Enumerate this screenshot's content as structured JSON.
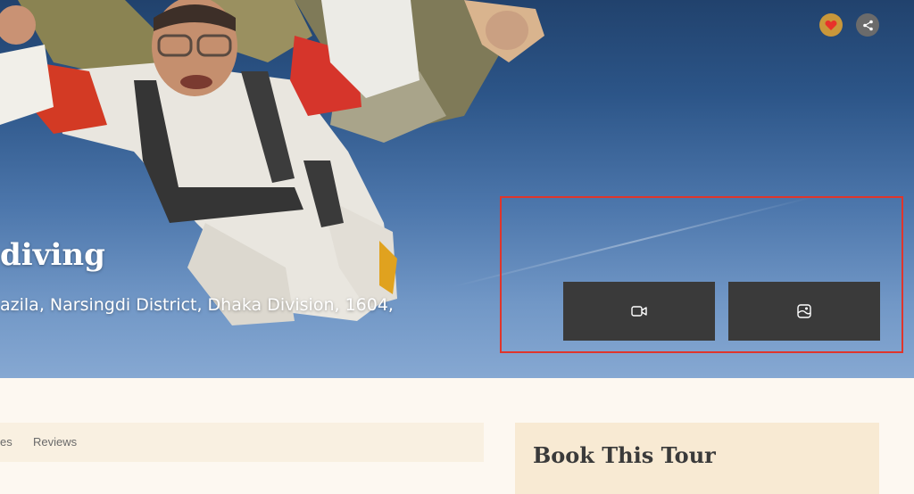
{
  "hero": {
    "title": "diving",
    "address": "azila, Narsingdi District, Dhaka Division, 1604,"
  },
  "actions": {
    "favorite_icon": "heart-icon",
    "share_icon": "share-icon",
    "favorite_color": "#c9973a",
    "heart_color": "#e8322a"
  },
  "media_buttons": {
    "video_icon": "video-camera-icon",
    "gallery_icon": "gallery-icon",
    "background": "#3a3a3a"
  },
  "highlight": {
    "border_color": "#e0352b"
  },
  "tabs": [
    {
      "label": "es"
    },
    {
      "label": "Reviews"
    }
  ],
  "booking": {
    "title": "Book This Tour"
  }
}
